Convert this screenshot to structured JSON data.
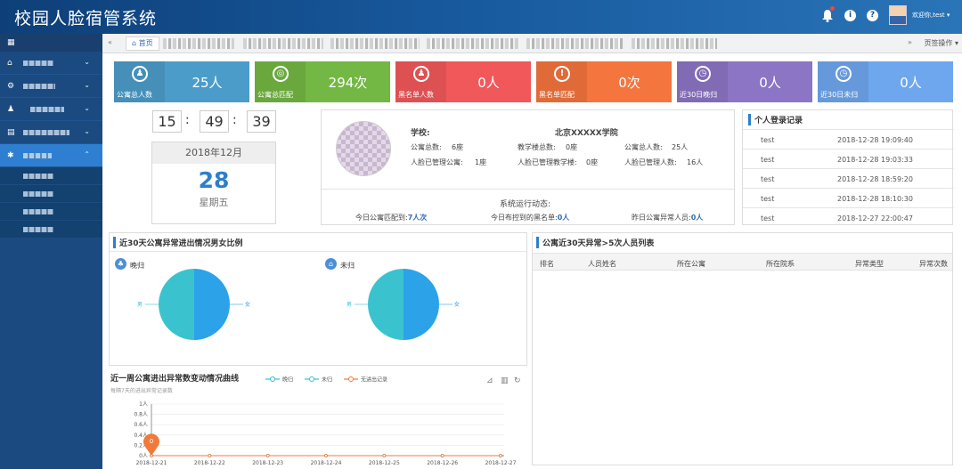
{
  "header": {
    "title": "校园人脸宿管系统",
    "welcome": "欢迎你,test"
  },
  "tabs": {
    "home": "首页",
    "ops": "页签操作"
  },
  "stats": [
    {
      "label": "公寓总人数",
      "value": "25人",
      "color": "#4b9cc9",
      "icon": "users-icon"
    },
    {
      "label": "公寓总匹配",
      "value": "294次",
      "color": "#73b744",
      "icon": "target-icon"
    },
    {
      "label": "黑名单人数",
      "value": "0人",
      "color": "#f0585a",
      "icon": "blacklist-user-icon"
    },
    {
      "label": "黑名单匹配",
      "value": "0次",
      "color": "#f4753e",
      "icon": "alert-icon"
    },
    {
      "label": "近30日晚归",
      "value": "0人",
      "color": "#8c75c4",
      "icon": "clock-icon"
    },
    {
      "label": "近30日未归",
      "value": "0人",
      "color": "#6ea7ee",
      "icon": "clock-icon"
    }
  ],
  "clock": {
    "h": "15",
    "m": "49",
    "s": "39"
  },
  "date": {
    "month": "2018年12月",
    "day": "28",
    "weekday": "星期五"
  },
  "school": {
    "label": "学校:",
    "name": "北京XXXXX学院",
    "r1": [
      "公寓总数:",
      "6座",
      "教学楼总数:",
      "0座",
      "公寓总人数:",
      "25人"
    ],
    "r2": [
      "人脸已管理公寓:",
      "1座",
      "人脸已管理教学楼:",
      "0座",
      "人脸已管理人数:",
      "16人"
    ],
    "status_title": "系统运行动态:",
    "s1_label": "今日公寓匹配到:",
    "s1_val": "7人次",
    "s2_label": "今日布控到的黑名单:",
    "s2_val": "0人",
    "s3_label": "昨日公寓异常人员:",
    "s3_val": "0人"
  },
  "login": {
    "title": "个人登录记录",
    "rows": [
      {
        "user": "test",
        "time": "2018-12-28 19:09:40"
      },
      {
        "user": "test",
        "time": "2018-12-28 19:03:33"
      },
      {
        "user": "test",
        "time": "2018-12-28 18:59:20"
      },
      {
        "user": "test",
        "time": "2018-12-28 18:10:30"
      },
      {
        "user": "test",
        "time": "2018-12-27 22:00:47"
      }
    ]
  },
  "gender": {
    "title": "近30天公寓异常进出情况男女比例",
    "pie1_title": "晚归",
    "pie2_title": "未归",
    "male": "男",
    "female": "女"
  },
  "abnormal": {
    "title": "公寓近30天异常>5次人员列表",
    "cols": [
      "排名",
      "人员姓名",
      "所在公寓",
      "所在院系",
      "异常类型",
      "异常次数"
    ]
  },
  "chart_data": {
    "type": "line",
    "title": "近一周公寓进出异常数变动情况曲线",
    "subtitle": "每隔7天的进出异常记录数",
    "legend": [
      "晚归",
      "未归",
      "无进出记录"
    ],
    "legend_colors": [
      "#2fc3d1",
      "#2fc3d1",
      "#f07a3c"
    ],
    "categories": [
      "2018-12-21",
      "2018-12-22",
      "2018-12-23",
      "2018-12-24",
      "2018-12-25",
      "2018-12-26",
      "2018-12-27"
    ],
    "ylim": [
      0,
      1
    ],
    "yticks": [
      "0人",
      "0.2人",
      "0.4人",
      "0.6人",
      "0.8人",
      "1人"
    ],
    "series": [
      {
        "name": "晚归",
        "values": [
          0,
          0,
          0,
          0,
          0,
          0,
          0
        ]
      },
      {
        "name": "未归",
        "values": [
          0,
          0,
          0,
          0,
          0,
          0,
          0
        ]
      },
      {
        "name": "无进出记录",
        "values": [
          0,
          0,
          0,
          0,
          0,
          0,
          0
        ]
      }
    ],
    "marker": "0"
  }
}
